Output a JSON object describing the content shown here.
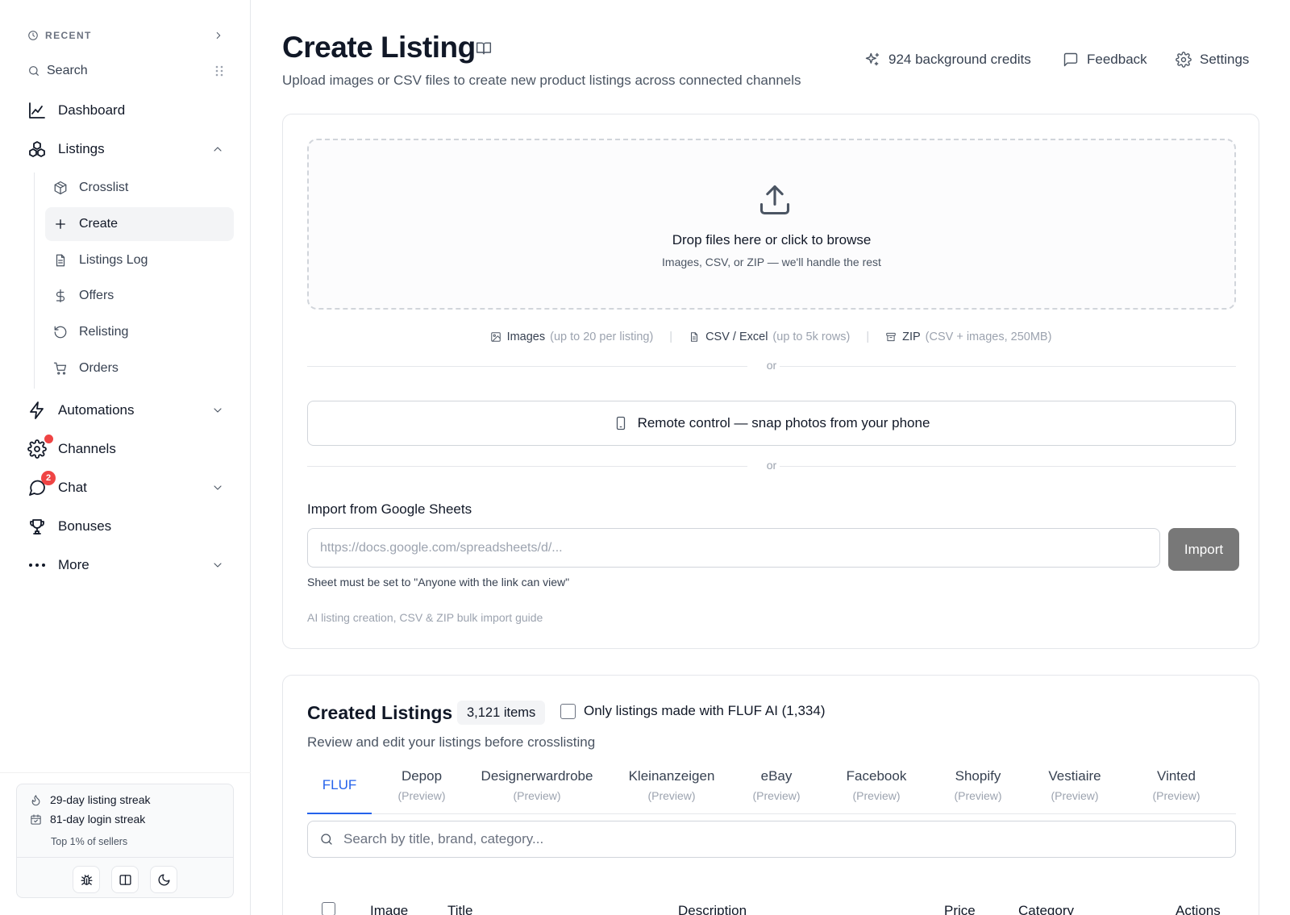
{
  "sidebar": {
    "recent_label": "RECENT",
    "search_label": "Search",
    "nav": {
      "dashboard": "Dashboard",
      "listings": "Listings",
      "automations": "Automations",
      "channels": "Channels",
      "chat": "Chat",
      "chat_badge": "2",
      "bonuses": "Bonuses",
      "more": "More"
    },
    "listings_sub": {
      "crosslist": "Crosslist",
      "create": "Create",
      "listings_log": "Listings Log",
      "offers": "Offers",
      "relisting": "Relisting",
      "orders": "Orders"
    },
    "streaks": {
      "listing": "29-day listing streak",
      "login": "81-day login streak",
      "rank": "Top 1% of sellers"
    }
  },
  "header": {
    "title": "Create Listing",
    "subtitle": "Upload images or CSV files to create new product listings across connected channels",
    "credits": "924 background credits",
    "feedback": "Feedback",
    "settings": "Settings"
  },
  "upload": {
    "drop_title": "Drop files here or click to browse",
    "drop_sub": "Images, CSV, or ZIP — we'll handle the rest",
    "formats": [
      {
        "name": "Images",
        "note": "(up to 20 per listing)"
      },
      {
        "name": "CSV / Excel",
        "note": "(up to 5k rows)"
      },
      {
        "name": "ZIP",
        "note": "(CSV + images, 250MB)"
      }
    ],
    "format_sep": "|",
    "or": "or",
    "remote": "Remote control — snap photos from your phone",
    "sheets_label": "Import from Google Sheets",
    "sheets_placeholder": "https://docs.google.com/spreadsheets/d/...",
    "import_button": "Import",
    "sheets_hint": "Sheet must be set to \"Anyone with the link can view\"",
    "guide_link": "AI listing creation, CSV & ZIP bulk import guide"
  },
  "created": {
    "title": "Created Listings",
    "count": "3,121 items",
    "filter": "Only listings made with FLUF AI (1,334)",
    "subtitle": "Review and edit your listings before crosslisting",
    "tabs": [
      {
        "label": "FLUF",
        "sub": ""
      },
      {
        "label": "Depop",
        "sub": "(Preview)"
      },
      {
        "label": "Designerwardrobe",
        "sub": "(Preview)"
      },
      {
        "label": "Kleinanzeigen",
        "sub": "(Preview)"
      },
      {
        "label": "eBay",
        "sub": "(Preview)"
      },
      {
        "label": "Facebook",
        "sub": "(Preview)"
      },
      {
        "label": "Shopify",
        "sub": "(Preview)"
      },
      {
        "label": "Vestiaire",
        "sub": "(Preview)"
      },
      {
        "label": "Vinted",
        "sub": "(Preview)"
      }
    ],
    "search_placeholder": "Search by title, brand, category...",
    "columns": [
      "Image",
      "Title",
      "Description",
      "Price",
      "Category",
      "Actions"
    ]
  },
  "colors": {
    "accent": "#2563eb",
    "badge": "#ef4444",
    "import_button": "#787878"
  }
}
